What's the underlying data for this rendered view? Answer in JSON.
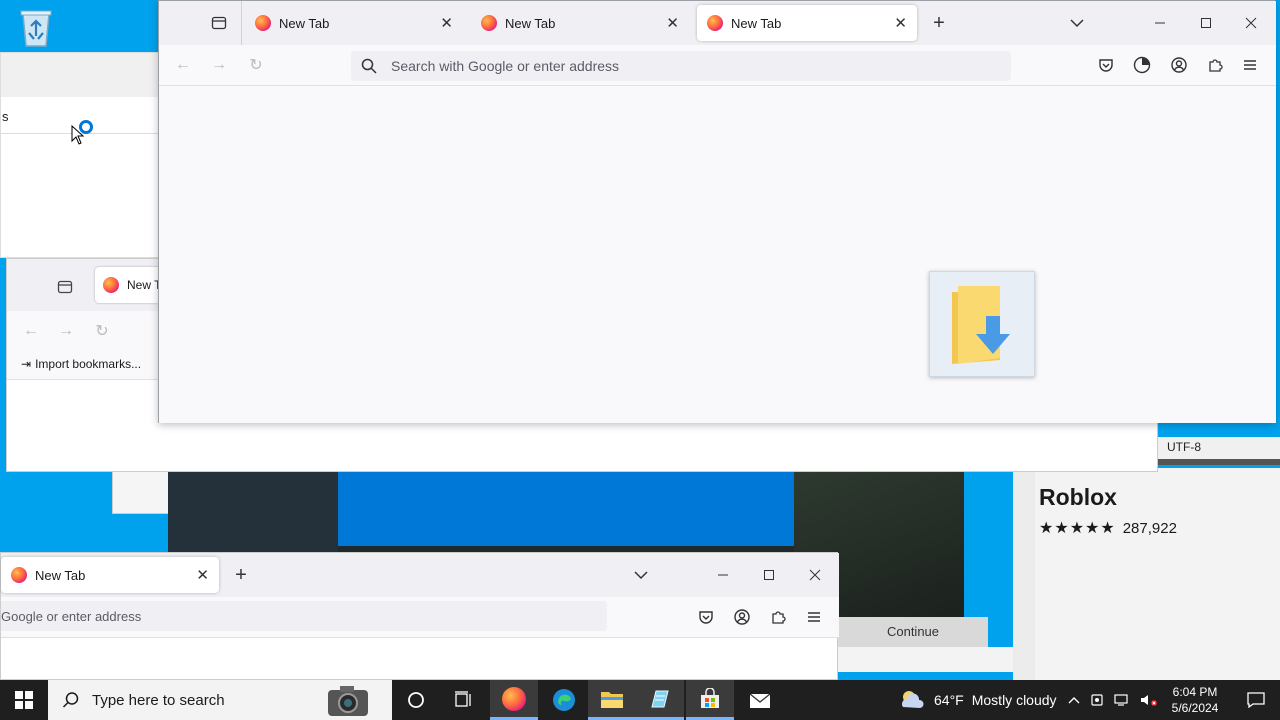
{
  "desktop": {
    "recycle_bin": "recycle-bin-icon",
    "store": {
      "title": "Roblox",
      "stars": "★★★★★",
      "rating_count": "287,922",
      "continue_label": "Continue"
    },
    "encoding_label": "UTF-8"
  },
  "back_window": {
    "field_text": "s"
  },
  "mid_window": {
    "tab_label": "New Tab",
    "import_bookmarks": "Import bookmarks..."
  },
  "main_window": {
    "tabs": [
      {
        "label": "New Tab"
      },
      {
        "label": "New Tab"
      },
      {
        "label": "New Tab"
      }
    ],
    "url_placeholder": "Search with Google or enter address"
  },
  "bottom_window": {
    "tab_label": "New Tab",
    "url_placeholder": "Google or enter address"
  },
  "taskbar": {
    "search_placeholder": "Type here to search",
    "weather_temp": "64°F",
    "weather_text": "Mostly cloudy",
    "time": "6:04 PM",
    "date": "5/6/2024"
  }
}
